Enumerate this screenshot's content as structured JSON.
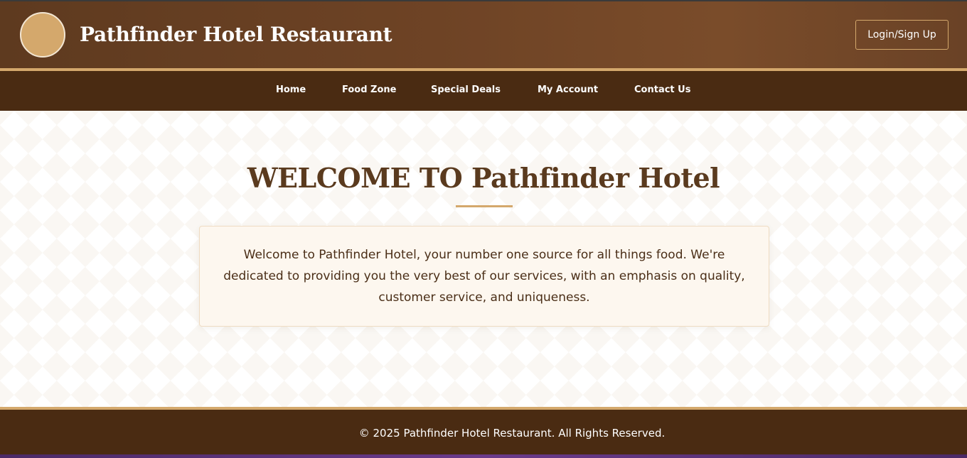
{
  "header": {
    "brand": "Pathfinder Hotel Restaurant",
    "login_label": "Login/Sign Up"
  },
  "nav": {
    "items": [
      {
        "label": "Home"
      },
      {
        "label": "Food Zone"
      },
      {
        "label": "Special Deals"
      },
      {
        "label": "My Account"
      },
      {
        "label": "Contact Us"
      }
    ]
  },
  "main": {
    "title": "WELCOME TO Pathfinder Hotel",
    "intro": "Welcome to Pathfinder Hotel, your number one source for all things food. We're dedicated to providing you the very best of our services, with an emphasis on quality, customer service, and uniqueness."
  },
  "footer": {
    "copyright": "© 2025 Pathfinder Hotel Restaurant. All Rights Reserved."
  },
  "colors": {
    "header_brown": "#6e4325",
    "nav_brown": "#4a2b12",
    "accent_gold": "#d4a86c",
    "title_brown": "#5a3a1e",
    "box_cream": "#fdf7ef"
  }
}
